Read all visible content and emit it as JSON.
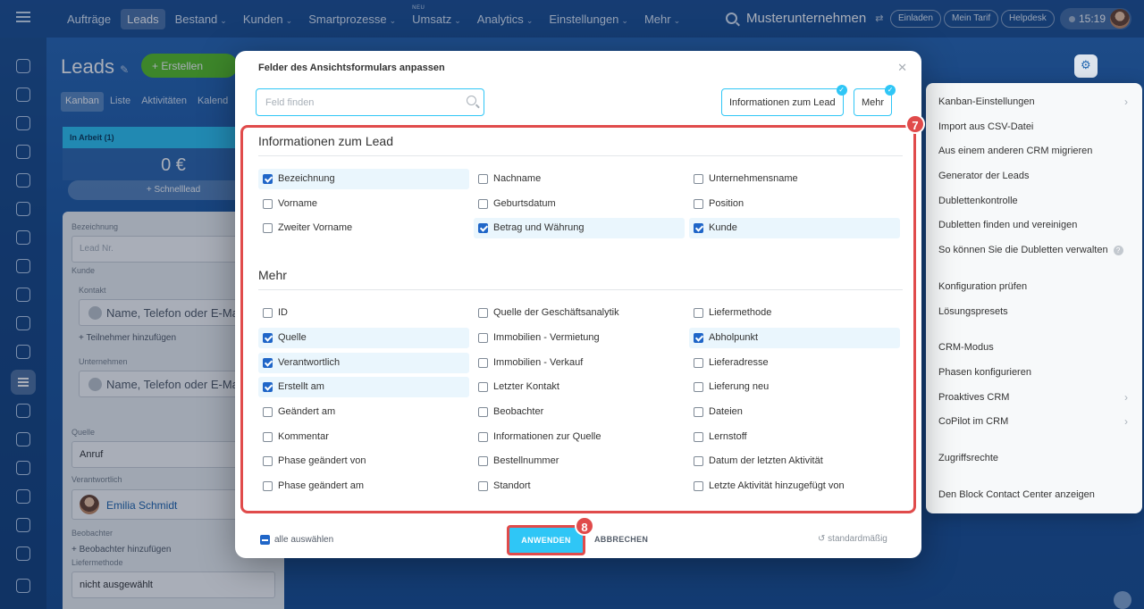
{
  "topnav": {
    "items": [
      {
        "label": "Aufträge",
        "active": false,
        "chevron": false
      },
      {
        "label": "Leads",
        "active": true,
        "chevron": false
      },
      {
        "label": "Bestand",
        "active": false,
        "chevron": true
      },
      {
        "label": "Kunden",
        "active": false,
        "chevron": true
      },
      {
        "label": "Smartprozesse",
        "active": false,
        "chevron": true
      },
      {
        "label": "Umsatz",
        "active": false,
        "chevron": true,
        "badge": "NEU"
      },
      {
        "label": "Analytics",
        "active": false,
        "chevron": true
      },
      {
        "label": "Einstellungen",
        "active": false,
        "chevron": true
      },
      {
        "label": "Mehr",
        "active": false,
        "chevron": true
      }
    ],
    "company": "Musterunternehmen",
    "buttons": [
      "Einladen",
      "Mein Tarif",
      "Helpdesk"
    ],
    "clock": "15:19"
  },
  "page": {
    "title": "Leads",
    "create_label": "+ Erstellen",
    "view_tabs": [
      "Kanban",
      "Liste",
      "Aktivitäten",
      "Kalend"
    ]
  },
  "kanban": {
    "stage": "In Arbeit (1)",
    "sum": "0 €",
    "quick": "+ Schnelllead",
    "card": {
      "label_name": "Bezeichnung",
      "name_placeholder": "Lead Nr.",
      "label_client": "Kunde",
      "label_contact": "Kontakt",
      "contact_placeholder": "Name, Telefon oder E-Mail",
      "add_participant": "+ Teilnehmer hinzufügen",
      "label_company": "Unternehmen",
      "company_placeholder": "Name, Telefon oder E-Mail",
      "label_source": "Quelle",
      "source_value": "Anruf",
      "label_responsible": "Verantwortlich",
      "responsible": "Emilia Schmidt",
      "label_observer": "Beobachter",
      "add_observer": "+ Beobachter hinzufügen",
      "label_delivery": "Liefermethode",
      "delivery_value": "nicht ausgewählt"
    }
  },
  "right_menu": {
    "groups": [
      [
        {
          "label": "Kanban-Einstellungen",
          "arrow": true
        },
        {
          "label": "Import aus CSV-Datei"
        },
        {
          "label": "Aus einem anderen CRM migrieren"
        },
        {
          "label": "Generator der Leads"
        },
        {
          "label": "Dublettenkontrolle"
        },
        {
          "label": "Dubletten finden und vereinigen"
        },
        {
          "label": "So können Sie die Dubletten verwalten",
          "help": true
        }
      ],
      [
        {
          "label": "Konfiguration prüfen"
        },
        {
          "label": "Lösungspresets"
        }
      ],
      [
        {
          "label": "CRM-Modus"
        },
        {
          "label": "Phasen konfigurieren"
        },
        {
          "label": "Proaktives CRM",
          "arrow": true
        },
        {
          "label": "CoPilot im CRM",
          "arrow": true
        }
      ],
      [
        {
          "label": "Zugriffsrechte"
        }
      ],
      [
        {
          "label": "Den Block Contact Center anzeigen"
        }
      ]
    ]
  },
  "modal": {
    "title": "Felder des Ansichtsformulars anpassen",
    "search_placeholder": "Feld finden",
    "section_buttons": [
      "Informationen zum Lead",
      "Mehr"
    ],
    "sections": [
      {
        "title": "Informationen zum Lead",
        "columns": [
          [
            {
              "label": "Bezeichnung",
              "checked": true
            },
            {
              "label": "Vorname",
              "checked": false
            },
            {
              "label": "Zweiter Vorname",
              "checked": false
            }
          ],
          [
            {
              "label": "Nachname",
              "checked": false
            },
            {
              "label": "Geburtsdatum",
              "checked": false
            },
            {
              "label": "Betrag und Währung",
              "checked": true
            }
          ],
          [
            {
              "label": "Unternehmensname",
              "checked": false
            },
            {
              "label": "Position",
              "checked": false
            },
            {
              "label": "Kunde",
              "checked": true
            }
          ]
        ]
      },
      {
        "title": "Mehr",
        "columns": [
          [
            {
              "label": "ID",
              "checked": false
            },
            {
              "label": "Quelle",
              "checked": true
            },
            {
              "label": "Verantwortlich",
              "checked": true
            },
            {
              "label": "Erstellt am",
              "checked": true
            },
            {
              "label": "Geändert am",
              "checked": false
            },
            {
              "label": "Kommentar",
              "checked": false
            },
            {
              "label": "Phase geändert von",
              "checked": false
            },
            {
              "label": "Phase geändert am",
              "checked": false
            }
          ],
          [
            {
              "label": "Quelle der Geschäftsanalytik",
              "checked": false
            },
            {
              "label": "Immobilien - Vermietung",
              "checked": false
            },
            {
              "label": "Immobilien - Verkauf",
              "checked": false
            },
            {
              "label": "Letzter Kontakt",
              "checked": false
            },
            {
              "label": "Beobachter",
              "checked": false
            },
            {
              "label": "Informationen zur Quelle",
              "checked": false
            },
            {
              "label": "Bestellnummer",
              "checked": false
            },
            {
              "label": "Standort",
              "checked": false
            }
          ],
          [
            {
              "label": "Liefermethode",
              "checked": false
            },
            {
              "label": "Abholpunkt",
              "checked": true
            },
            {
              "label": "Lieferadresse",
              "checked": false
            },
            {
              "label": "Lieferung neu",
              "checked": false
            },
            {
              "label": "Dateien",
              "checked": false
            },
            {
              "label": "Lernstoff",
              "checked": false
            },
            {
              "label": "Datum der letzten Aktivität",
              "checked": false
            },
            {
              "label": "Letzte Aktivität hinzugefügt von",
              "checked": false
            }
          ]
        ]
      }
    ],
    "select_all": "alle auswählen",
    "apply": "ANWENDEN",
    "cancel": "ABBRECHEN",
    "default": "standardmäßig",
    "step_markers": [
      "7",
      "8"
    ]
  },
  "icons": {
    "close": "close-icon",
    "search": "search-icon",
    "check": "check-icon",
    "undo": "undo-icon"
  },
  "colors": {
    "accent": "#2fc6f6",
    "checkbox": "#2066c8",
    "highlight": "#e04b4b",
    "create": "#59c226"
  }
}
